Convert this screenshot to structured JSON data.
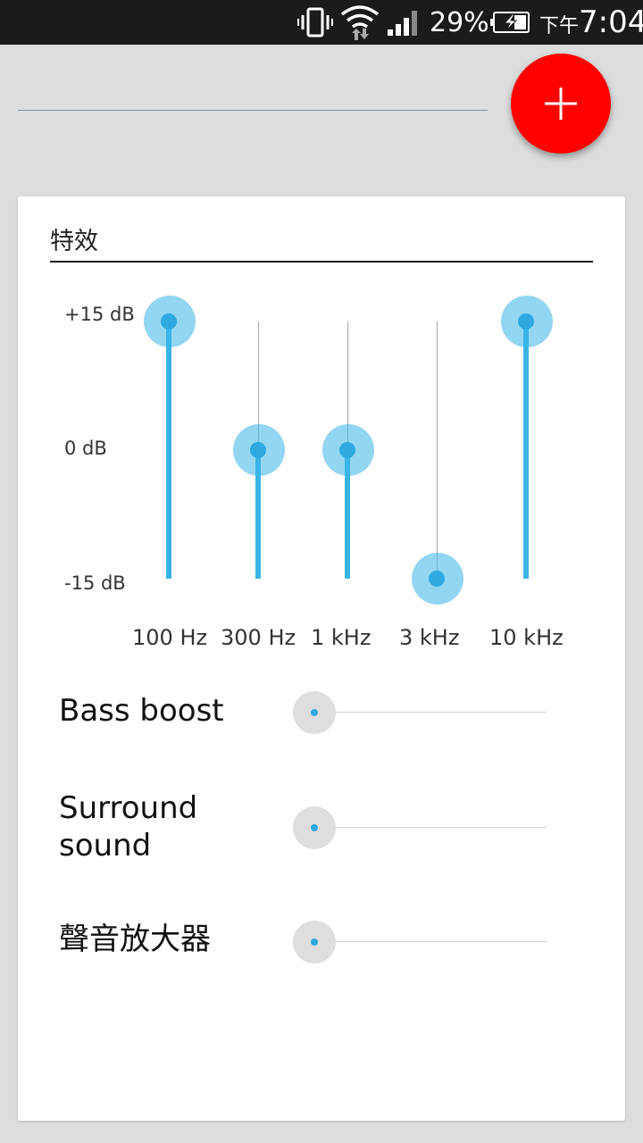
{
  "status_bar": {
    "battery_percent": "29%",
    "ampm": "下午",
    "time": "7:04",
    "icons": [
      "vibrate-icon",
      "wifi-icon",
      "signal-icon",
      "battery-charging-icon"
    ]
  },
  "fab": {
    "icon": "plus-icon",
    "color": "#ff0000"
  },
  "card": {
    "title": "特效",
    "equalizer": {
      "db_labels": {
        "top": "+15 dB",
        "mid": "0 dB",
        "bottom": "-15 dB"
      },
      "range_db": [
        -15,
        15
      ],
      "bands": [
        {
          "label": "100 Hz",
          "value_db": 15
        },
        {
          "label": "300 Hz",
          "value_db": 0
        },
        {
          "label": "1 kHz",
          "value_db": 0
        },
        {
          "label": "3 kHz",
          "value_db": -15
        },
        {
          "label": "10 kHz",
          "value_db": 15
        }
      ]
    },
    "effects": [
      {
        "label": "Bass boost",
        "value": 0
      },
      {
        "label": "Surround sound",
        "value": 0
      },
      {
        "label": "聲音放大器",
        "value": 0
      }
    ]
  },
  "colors": {
    "accent": "#39b4e6",
    "fab": "#ff0000",
    "background": "#dddddd"
  }
}
